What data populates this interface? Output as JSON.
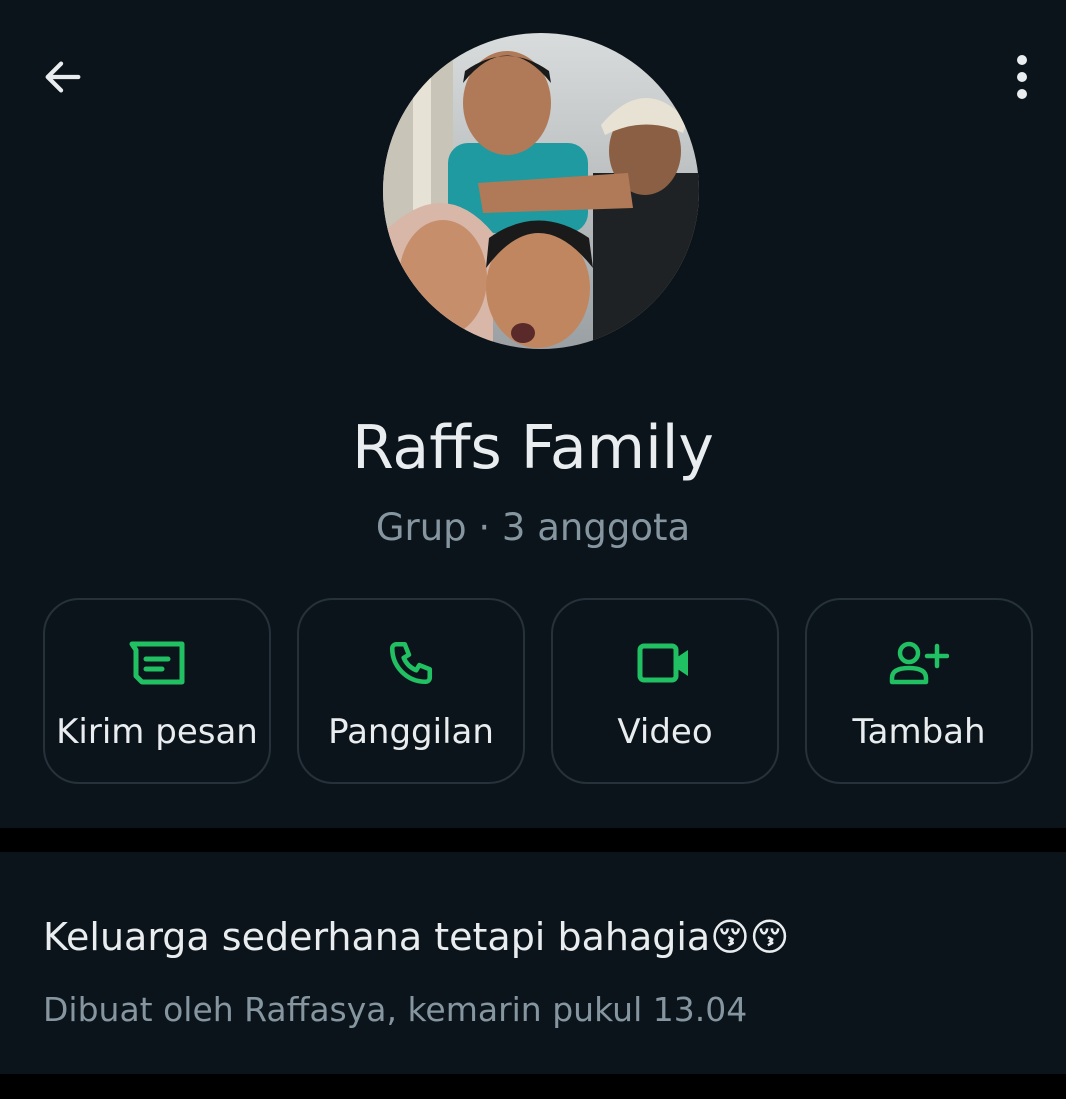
{
  "colors": {
    "background": "#0b141a",
    "divider": "#000000",
    "accent": "#21c063",
    "text_primary": "#e9edef",
    "text_secondary": "#8696a0",
    "button_border": "#26313a"
  },
  "header": {
    "back_icon": "arrow-left-icon",
    "menu_icon": "more-vertical-icon"
  },
  "profile": {
    "avatar": "group-photo",
    "name": "Raffs Family",
    "subtitle": "Grup · 3 anggota"
  },
  "actions": [
    {
      "label": "Kirim pesan",
      "icon": "message-icon"
    },
    {
      "label": "Panggilan",
      "icon": "phone-icon"
    },
    {
      "label": "Video",
      "icon": "video-camera-icon"
    },
    {
      "label": "Tambah",
      "icon": "add-person-icon"
    }
  ],
  "description": {
    "text": "Keluarga sederhana tetapi bahagia😚😚",
    "created": "Dibuat oleh Raffasya, kemarin pukul 13.04"
  }
}
